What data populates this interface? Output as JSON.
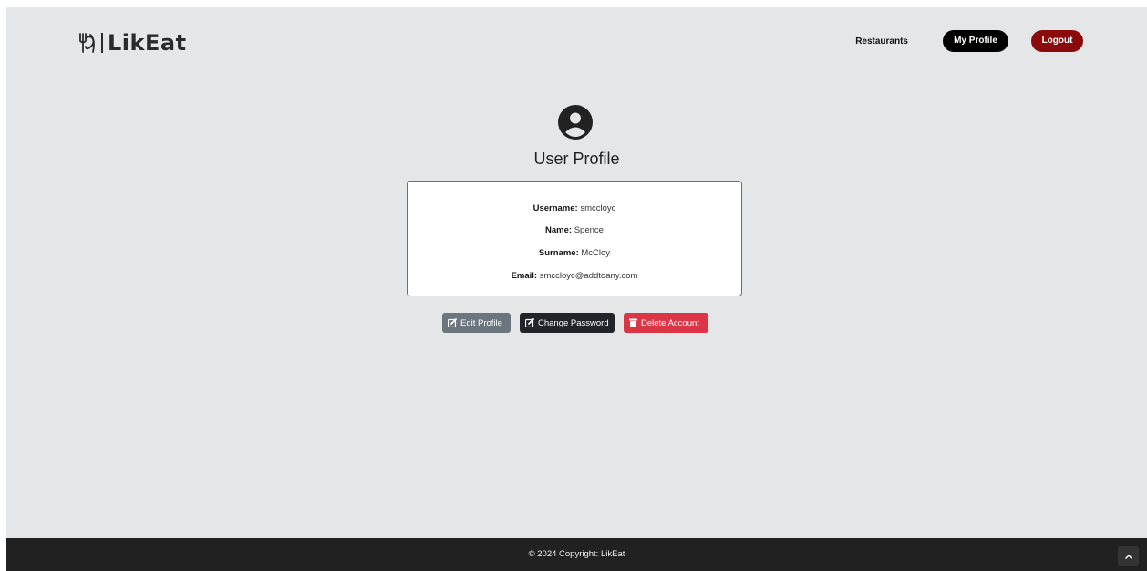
{
  "header": {
    "brand": "LikEat",
    "nav": {
      "restaurants": "Restaurants",
      "my_profile": "My Profile",
      "logout": "Logout"
    }
  },
  "profile": {
    "title": "User Profile",
    "fields": [
      {
        "label": "Username:",
        "value": "smccloyc"
      },
      {
        "label": "Name:",
        "value": "Spence"
      },
      {
        "label": "Surname:",
        "value": "McCloy"
      },
      {
        "label": "Email:",
        "value": "smccloyc@addtoany.com"
      }
    ]
  },
  "actions": {
    "edit_profile": "Edit Profile",
    "change_password": "Change Password",
    "delete_account": "Delete Account"
  },
  "footer": {
    "copyright": "© 2024 Copyright: LikEat"
  },
  "colors": {
    "page_bg": "#e5e6e8",
    "logout": "#8b0a0c",
    "edit": "#6c757d",
    "change_password": "#212529",
    "delete": "#dc3545",
    "footer": "#212121"
  },
  "icons": {
    "logo": "fork-knife-plate-icon",
    "avatar": "user-circle-icon",
    "edit": "pencil-square-icon",
    "change_password": "pencil-square-icon",
    "delete": "trash-icon",
    "scroll_top": "chevron-up-icon"
  }
}
